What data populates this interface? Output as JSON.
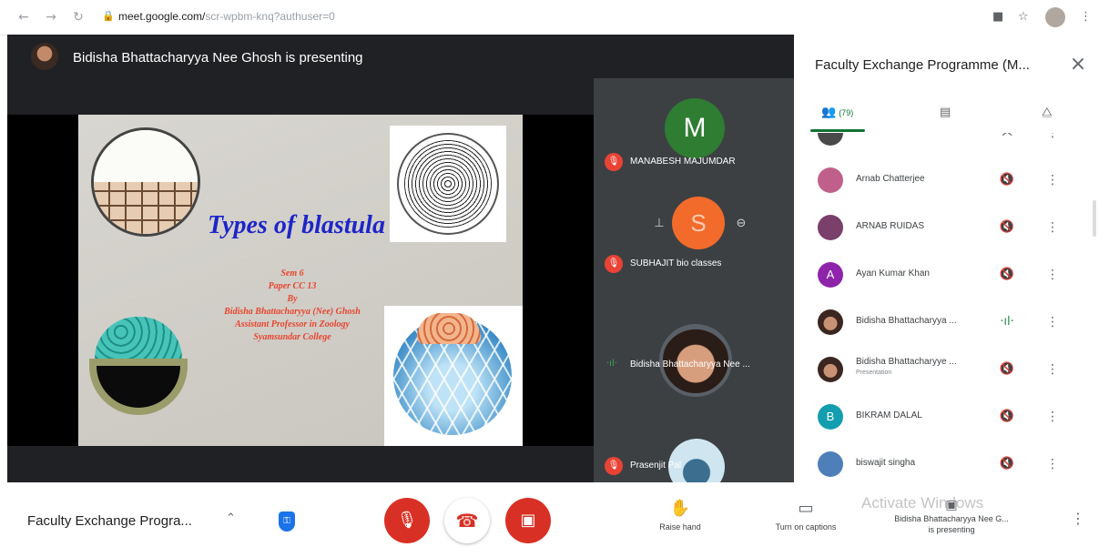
{
  "browser": {
    "url_host": "meet.google.com/",
    "url_rest": "scr-wpbm-knq?authuser=0"
  },
  "stage": {
    "presenting_text": "Bidisha Bhattacharyya Nee Ghosh is presenting",
    "slide": {
      "title": "Types of blastula",
      "lines": [
        "Sem 6",
        "Paper CC 13",
        "By",
        "Bidisha Bhattacharyya (Nee) Ghosh",
        "Assistant Professor in Zoology",
        "Syamsundar College"
      ]
    },
    "tiles": [
      {
        "initial": "M",
        "name": "MANABESH MAJUMDAR",
        "avatar_color": "#2e7d32"
      },
      {
        "initial": "S",
        "name": "SUBHAJIT bio classes",
        "avatar_color": "#f26b2b"
      },
      {
        "name": "Bidisha Bhattacharyya Nee ..."
      },
      {
        "name": "Prasenjit Pal"
      }
    ]
  },
  "panel": {
    "title": "Faculty Exchange Programme (M...",
    "people_count": "(79)",
    "participants": [
      {
        "name": "Arnab Chatterjee",
        "avatar_color": "#c0608a",
        "muted": true
      },
      {
        "name": "ARNAB RUIDAS",
        "avatar_color": "#7a3f6b",
        "muted": true
      },
      {
        "name": "Ayan Kumar Khan",
        "initial": "A",
        "avatar_color": "#8e24aa",
        "muted": true
      },
      {
        "name": "Bidisha Bhattacharyya ...",
        "avatar_color": "#5a3a2e",
        "muted": false
      },
      {
        "name": "Bidisha Bhattacharyye ...",
        "subtitle": "Presentation",
        "avatar_color": "#5a3a2e",
        "muted": true
      },
      {
        "name": "BIKRAM DALAL",
        "initial": "B",
        "avatar_color": "#129eaf",
        "muted": true
      },
      {
        "name": "biswajit singha",
        "avatar_color": "#4f7fb8",
        "muted": true
      }
    ]
  },
  "bottom": {
    "meeting_name": "Faculty Exchange Progra...",
    "raise_hand": "Raise hand",
    "captions": "Turn on captions",
    "watermark": "Activate Windows",
    "presenting_line1": "Bidisha Bhattacharyya Nee G...",
    "presenting_line2": "is presenting"
  },
  "colors": {
    "accent_green": "#137333",
    "danger_red": "#d93025",
    "stage_bg": "#202124"
  }
}
